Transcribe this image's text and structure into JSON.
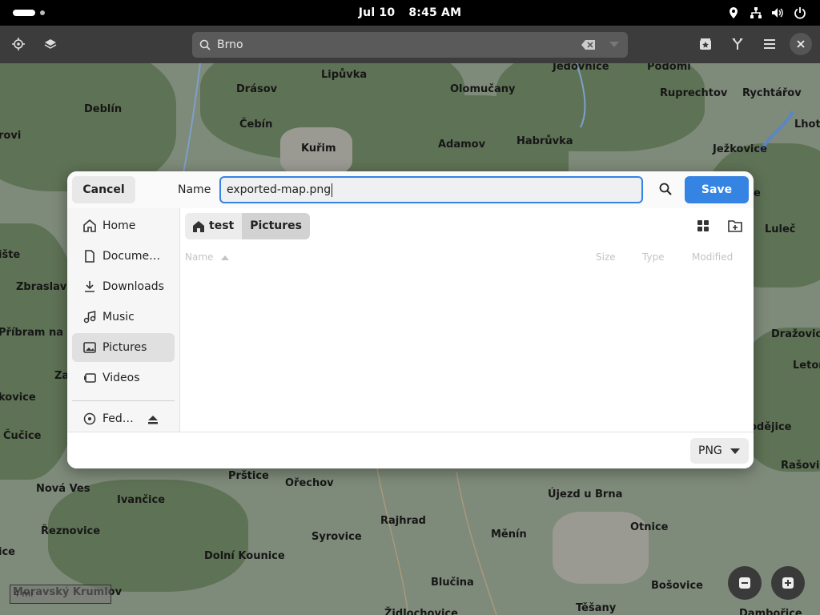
{
  "topbar": {
    "date": "Jul 10",
    "time": "8:45 AM",
    "tray_icons": [
      "location-icon",
      "network-icon",
      "volume-icon",
      "power-icon"
    ]
  },
  "maps": {
    "search_value": "Brno",
    "scale_label": "4 mi",
    "places": [
      {
        "name": "Lipůvka"
      },
      {
        "name": "Jedovnice"
      },
      {
        "name": "Podomí"
      },
      {
        "name": "Drásov"
      },
      {
        "name": "Olomučany"
      },
      {
        "name": "Ruprechtov"
      },
      {
        "name": "Rychtářov"
      },
      {
        "name": "Deblín"
      },
      {
        "name": "Lhota"
      },
      {
        "name": "rovi"
      },
      {
        "name": "Čebín"
      },
      {
        "name": "Kuřim"
      },
      {
        "name": "Adamov"
      },
      {
        "name": "Habrůvka"
      },
      {
        "name": "Ježkovice"
      },
      {
        "name": "Luleč"
      },
      {
        "name": "ište"
      },
      {
        "name": "Zbraslav"
      },
      {
        "name": "Příbram na M"
      },
      {
        "name": "Dražovice"
      },
      {
        "name": "Za"
      },
      {
        "name": "Letor"
      },
      {
        "name": "kovice"
      },
      {
        "name": "odějice"
      },
      {
        "name": "Čučice"
      },
      {
        "name": "Rašovic"
      },
      {
        "name": "Prštice"
      },
      {
        "name": "Ořechov"
      },
      {
        "name": "Nová Ves"
      },
      {
        "name": "Ivančice"
      },
      {
        "name": "Újezd u Brna"
      },
      {
        "name": "Řeznovice"
      },
      {
        "name": "Rajhrad"
      },
      {
        "name": "Syrovice"
      },
      {
        "name": "Měnín"
      },
      {
        "name": "Otnice"
      },
      {
        "name": "ice"
      },
      {
        "name": "Dolní Kounice"
      },
      {
        "name": "Moravský Krumlov"
      },
      {
        "name": "Blučina"
      },
      {
        "name": "Bošovice"
      },
      {
        "name": "Těšany"
      },
      {
        "name": "Židlochovice"
      },
      {
        "name": "Dambořice"
      },
      {
        "name": "e"
      }
    ]
  },
  "dialog": {
    "cancel_label": "Cancel",
    "name_label": "Name",
    "filename": "exported-map.png",
    "save_label": "Save",
    "places": [
      {
        "label": "Home",
        "icon": "home-icon"
      },
      {
        "label": "Docume…",
        "icon": "document-icon"
      },
      {
        "label": "Downloads",
        "icon": "download-icon"
      },
      {
        "label": "Music",
        "icon": "music-icon"
      },
      {
        "label": "Pictures",
        "icon": "pictures-icon",
        "selected": true
      },
      {
        "label": "Videos",
        "icon": "video-icon"
      },
      {
        "label": "Fed…",
        "icon": "disc-icon"
      }
    ],
    "breadcrumb": [
      "test",
      "Pictures"
    ],
    "columns": [
      "Name",
      "Size",
      "Type",
      "Modified"
    ],
    "file_type": "PNG"
  },
  "colors": {
    "accent": "#3584e4",
    "topbar": "#000000",
    "header": "#3c3c3c",
    "map_land": "#7e8a7a",
    "forest": "#5e7255"
  }
}
